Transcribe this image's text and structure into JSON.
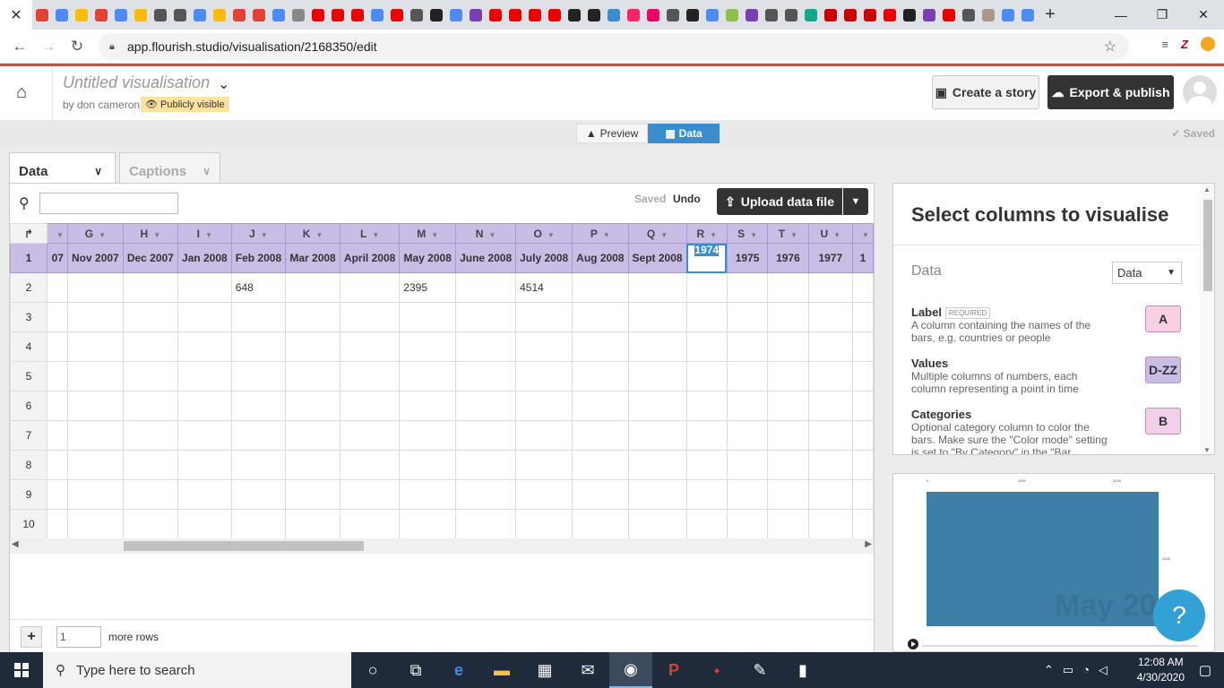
{
  "browser": {
    "url": "app.flourish.studio/visualisation/2168350/edit",
    "favicon_colors": [
      "#e34133",
      "#4c8bf5",
      "#fbbc05",
      "#e34133",
      "#4c8bf5",
      "#fbbc05",
      "#555",
      "#555",
      "#4c8bf5",
      "#fbbc05",
      "#e34133",
      "#e34133",
      "#4c8bf5",
      "#888",
      "#e00",
      "#e00",
      "#e00",
      "#4c8bf5",
      "#e00",
      "#555",
      "#222",
      "#4c8bf5",
      "#7b3fb5",
      "#e00",
      "#e00",
      "#e00",
      "#e00",
      "#222",
      "#222",
      "#3a8ed0",
      "#f26",
      "#e06",
      "#555",
      "#222",
      "#4c8bf5",
      "#8bc34a",
      "#7b3fb5",
      "#555",
      "#555",
      "#1a8",
      "#c00",
      "#c00",
      "#c00",
      "#e00",
      "#222",
      "#7b3fb5",
      "#e00",
      "#555",
      "#a98",
      "#4c8bf5",
      "#4c8bf5"
    ]
  },
  "header": {
    "title": "Untitled visualisation",
    "byline": "by don cameron",
    "visibility_badge": "Publicly visible",
    "create_story_label": "Create a story",
    "export_label": "Export & publish"
  },
  "modebar": {
    "preview_label": "Preview",
    "data_label": "Data",
    "saved_status": "Saved"
  },
  "sheet_tabs": {
    "data_label": "Data",
    "captions_label": "Captions"
  },
  "toolbar": {
    "saved_label": "Saved",
    "undo_label": "Undo",
    "upload_label": "Upload data file"
  },
  "grid": {
    "columns": [
      "",
      "G",
      "H",
      "I",
      "J",
      "K",
      "L",
      "M",
      "N",
      "O",
      "P",
      "Q",
      "R",
      "S",
      "T",
      "U",
      ""
    ],
    "rows": [
      {
        "num": "1",
        "cells": [
          "07",
          "Nov 2007",
          "Dec 2007",
          "Jan 2008",
          "Feb 2008",
          "Mar 2008",
          "April 2008",
          "May 2008",
          "June 2008",
          "July 2008",
          "Aug 2008",
          "Sept 2008",
          "1974",
          "1975",
          "1976",
          "1977",
          "1"
        ]
      },
      {
        "num": "2",
        "cells": [
          "",
          "",
          "",
          "",
          "648",
          "",
          "",
          "2395",
          "",
          "4514",
          "",
          "",
          "",
          "",
          "",
          "",
          ""
        ]
      },
      {
        "num": "3",
        "cells": [
          "",
          "",
          "",
          "",
          "",
          "",
          "",
          "",
          "",
          "",
          "",
          "",
          "",
          "",
          "",
          "",
          ""
        ]
      },
      {
        "num": "4",
        "cells": [
          "",
          "",
          "",
          "",
          "",
          "",
          "",
          "",
          "",
          "",
          "",
          "",
          "",
          "",
          "",
          "",
          ""
        ]
      },
      {
        "num": "5",
        "cells": [
          "",
          "",
          "",
          "",
          "",
          "",
          "",
          "",
          "",
          "",
          "",
          "",
          "",
          "",
          "",
          "",
          ""
        ]
      },
      {
        "num": "6",
        "cells": [
          "",
          "",
          "",
          "",
          "",
          "",
          "",
          "",
          "",
          "",
          "",
          "",
          "",
          "",
          "",
          "",
          ""
        ]
      },
      {
        "num": "7",
        "cells": [
          "",
          "",
          "",
          "",
          "",
          "",
          "",
          "",
          "",
          "",
          "",
          "",
          "",
          "",
          "",
          "",
          ""
        ]
      },
      {
        "num": "8",
        "cells": [
          "",
          "",
          "",
          "",
          "",
          "",
          "",
          "",
          "",
          "",
          "",
          "",
          "",
          "",
          "",
          "",
          ""
        ]
      },
      {
        "num": "9",
        "cells": [
          "",
          "",
          "",
          "",
          "",
          "",
          "",
          "",
          "",
          "",
          "",
          "",
          "",
          "",
          "",
          "",
          ""
        ]
      },
      {
        "num": "10",
        "cells": [
          "",
          "",
          "",
          "",
          "",
          "",
          "",
          "",
          "",
          "",
          "",
          "",
          "",
          "",
          "",
          "",
          ""
        ]
      }
    ],
    "selected_cell_value": "1974"
  },
  "add_rows": {
    "count": "1",
    "label": "more rows"
  },
  "column_panel": {
    "title": "Select columns to visualise",
    "data_label": "Data",
    "sheet_select": "Data",
    "bindings": [
      {
        "name": "Label",
        "required": "REQUIRED",
        "desc": "A column containing the names of the bars, e.g. countries or people",
        "columns": "A",
        "color": "#f9d0e3"
      },
      {
        "name": "Values",
        "required": "",
        "desc": "Multiple columns of numbers, each column representing a point in time",
        "columns": "D-ZZ",
        "color": "#c9bde6"
      },
      {
        "name": "Categories",
        "required": "",
        "desc": "Optional category column to color the bars. Make sure the \"Color mode\" setting is set to \"By Category\" in the \"Bar",
        "columns": "B",
        "color": "#f2d0ea"
      }
    ]
  },
  "preview": {
    "axis_ticks": [
      "0",
      "1000",
      "2000"
    ],
    "bar_label": "",
    "bar_value": "2435",
    "watermark": "May 20",
    "bar_color": "#3f7ea6"
  },
  "help_label": "?",
  "taskbar": {
    "search_placeholder": "Type here to search",
    "time": "12:08 AM",
    "date": "4/30/2020"
  }
}
